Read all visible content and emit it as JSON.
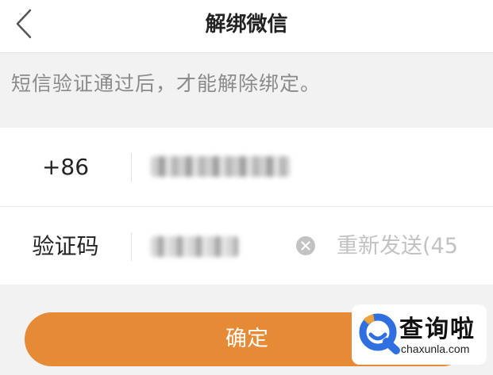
{
  "header": {
    "title": "解绑微信",
    "back_icon": "chevron-left-icon"
  },
  "hint_text": "短信验证通过后，才能解除绑定。",
  "form": {
    "phone_prefix": "+86",
    "code_label": "验证码",
    "clear_icon": "clear-circle-icon",
    "resend_text": "重新发送(45"
  },
  "confirm_label": "确定",
  "watermark": {
    "brand_cn": "查询啦",
    "brand_en": "chaxunla.com"
  },
  "colors": {
    "accent": "#e68a35",
    "background": "#f2f2f2",
    "hint_text": "#8a8a8a",
    "disabled_text": "#c2c2c2",
    "watermark_blue": "#2f6fe0"
  }
}
